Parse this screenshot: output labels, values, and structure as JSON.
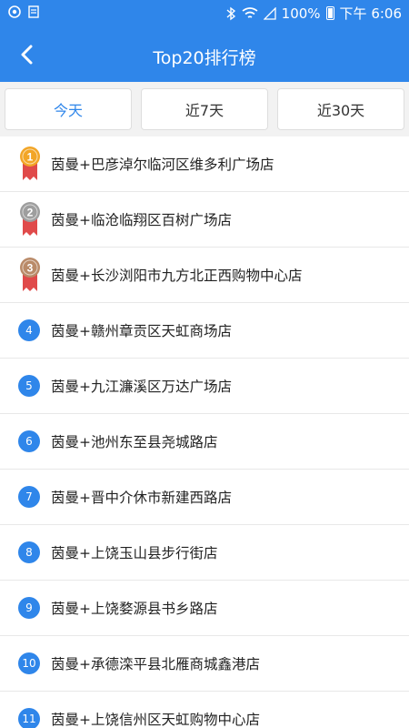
{
  "status_bar": {
    "battery": "100%",
    "time": "下午 6:06"
  },
  "nav": {
    "title": "Top20排行榜"
  },
  "tabs": [
    {
      "label": "今天",
      "active": true
    },
    {
      "label": "近7天",
      "active": false
    },
    {
      "label": "近30天",
      "active": false
    }
  ],
  "colors": {
    "primary": "#2f86ea",
    "gold": "#f2a526",
    "silver": "#9e9e9e",
    "bronze": "#b98a68",
    "ribbon": "#e04a4a"
  },
  "ranking": [
    {
      "rank": "1",
      "name": "茵曼+巴彦淖尔临河区维多利广场店",
      "medal": "gold"
    },
    {
      "rank": "2",
      "name": "茵曼+临沧临翔区百树广场店",
      "medal": "silver"
    },
    {
      "rank": "3",
      "name": "茵曼+长沙浏阳市九方北正西购物中心店",
      "medal": "bronze"
    },
    {
      "rank": "4",
      "name": "茵曼+赣州章贡区天虹商场店"
    },
    {
      "rank": "5",
      "name": "茵曼+九江濂溪区万达广场店"
    },
    {
      "rank": "6",
      "name": "茵曼+池州东至县尧城路店"
    },
    {
      "rank": "7",
      "name": "茵曼+晋中介休市新建西路店"
    },
    {
      "rank": "8",
      "name": "茵曼+上饶玉山县步行街店"
    },
    {
      "rank": "9",
      "name": "茵曼+上饶婺源县书乡路店"
    },
    {
      "rank": "10",
      "name": "茵曼+承德滦平县北雁商城鑫港店"
    },
    {
      "rank": "11",
      "name": "茵曼+上饶信州区天虹购物中心店"
    }
  ]
}
